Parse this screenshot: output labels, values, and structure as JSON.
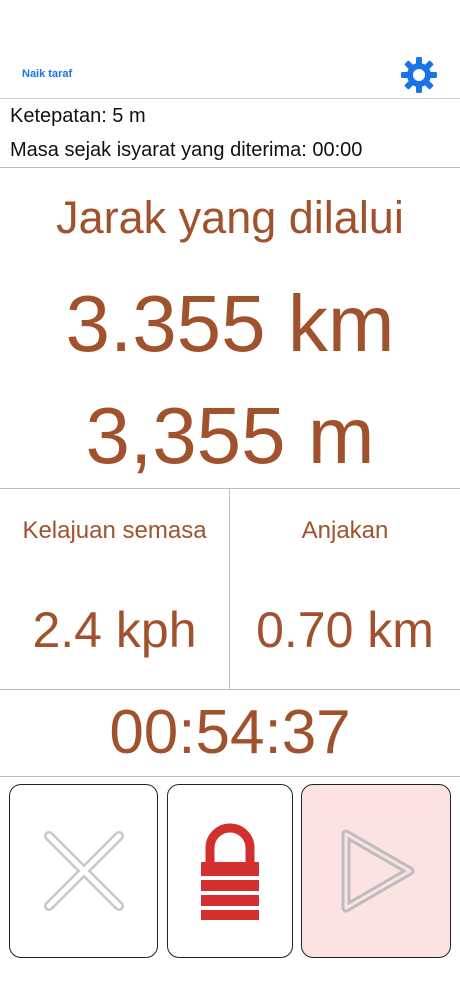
{
  "header": {
    "upgrade_label": "Naik taraf",
    "settings_icon": "gear-icon"
  },
  "info": {
    "accuracy": "Ketepatan: 5 m",
    "time_since_signal": "Masa sejak isyarat yang diterima: 00:00"
  },
  "distance": {
    "title": "Jarak yang dilalui",
    "km": "3.355 km",
    "m": "3,355 m"
  },
  "stats": {
    "current_speed_label": "Kelajuan semasa",
    "current_speed_value": "2.4 kph",
    "projection_label": "Anjakan",
    "projection_value": "0.70 km"
  },
  "timer": {
    "elapsed": "00:54:37"
  },
  "controls": {
    "cancel_icon": "close-icon",
    "lock_icon": "lock-icon",
    "play_icon": "play-icon"
  },
  "colors": {
    "accent_text": "#a0522d",
    "link_blue": "#1a73e8",
    "lock_red": "#d32f2f",
    "play_bg": "#fde2e2",
    "icon_gray": "#c8c8c8"
  }
}
